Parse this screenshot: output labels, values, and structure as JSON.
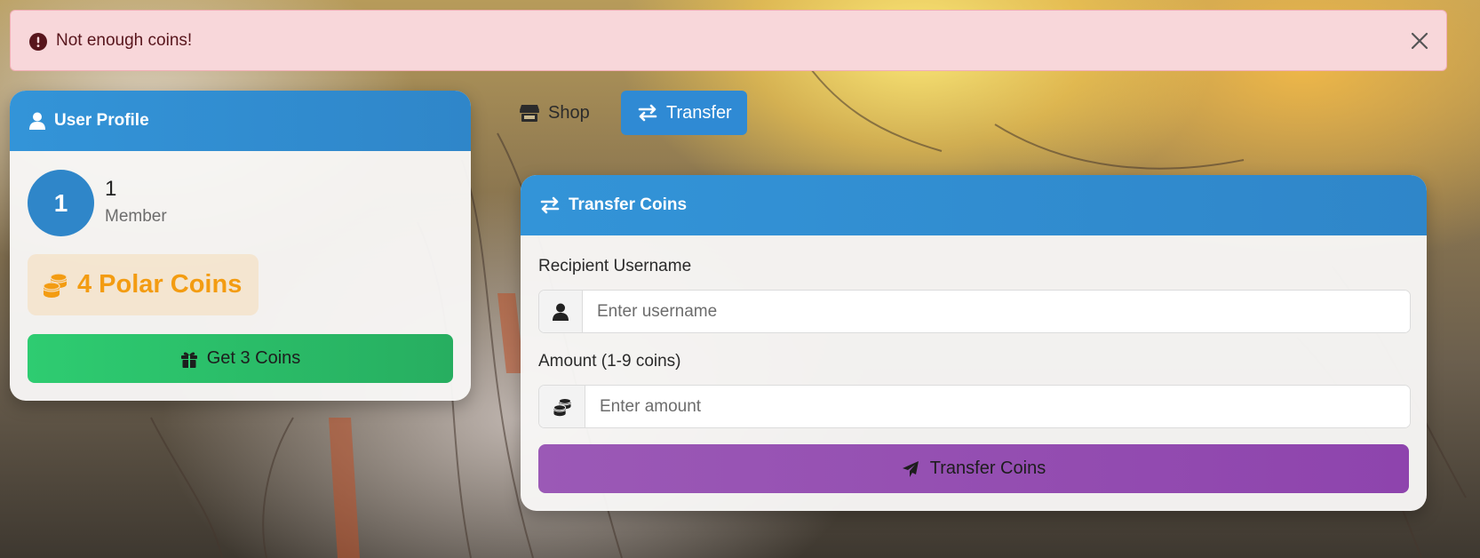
{
  "alert": {
    "message": "Not enough coins!"
  },
  "profile": {
    "header": "User Profile",
    "avatar_initial": "1",
    "username": "1",
    "role": "Member",
    "coins_text": "4 Polar Coins",
    "claim_button": "Get 3 Coins"
  },
  "nav": {
    "shop": "Shop",
    "transfer": "Transfer"
  },
  "transfer": {
    "header": "Transfer Coins",
    "recipient_label": "Recipient Username",
    "recipient_placeholder": "Enter username",
    "amount_label": "Amount (1-9 coins)",
    "amount_placeholder": "Enter amount",
    "submit_button": "Transfer Coins"
  },
  "colors": {
    "primary": "#2f86c9",
    "success": "#2ecc71",
    "purple": "#9b59b6",
    "coin": "#f39c12",
    "alert_bg": "#f8d7da",
    "alert_text": "#58151c"
  }
}
